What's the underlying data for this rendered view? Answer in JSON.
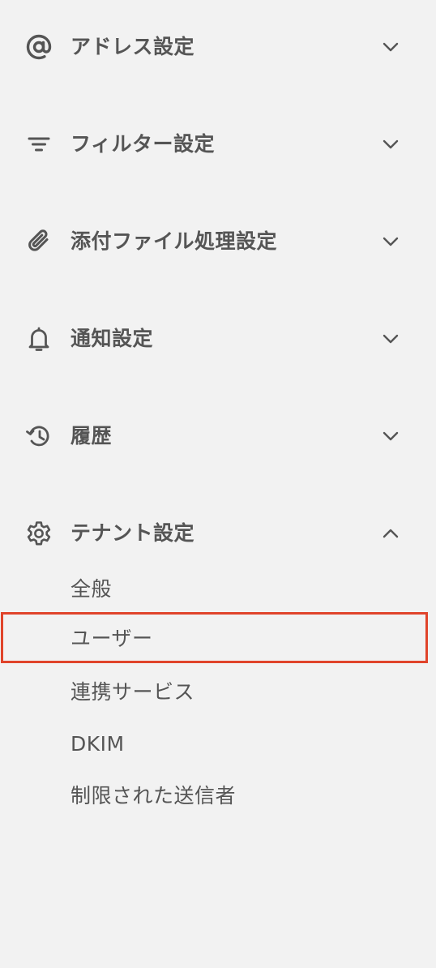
{
  "sidebar": {
    "sections": [
      {
        "label": "アドレス設定",
        "icon": "at-sign-icon",
        "expanded": false
      },
      {
        "label": "フィルター設定",
        "icon": "filter-icon",
        "expanded": false
      },
      {
        "label": "添付ファイル処理設定",
        "icon": "paperclip-icon",
        "expanded": false
      },
      {
        "label": "通知設定",
        "icon": "bell-icon",
        "expanded": false
      },
      {
        "label": "履歴",
        "icon": "history-icon",
        "expanded": false
      },
      {
        "label": "テナント設定",
        "icon": "gear-icon",
        "expanded": true
      }
    ],
    "tenant_items": [
      {
        "label": "全般"
      },
      {
        "label": "ユーザー",
        "highlighted": true
      },
      {
        "label": "連携サービス"
      },
      {
        "label": "DKIM"
      },
      {
        "label": "制限された送信者"
      }
    ]
  },
  "colors": {
    "background": "#f2f2f2",
    "text": "#555555",
    "highlight_border": "#e0442b"
  }
}
